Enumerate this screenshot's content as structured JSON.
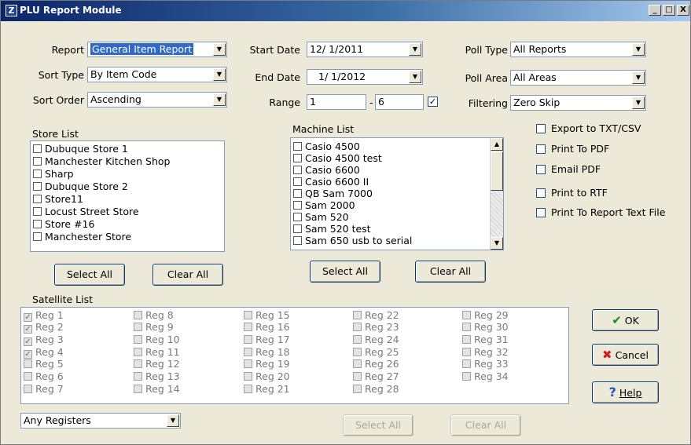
{
  "window": {
    "title": "PLU Report Module",
    "minimize": "_",
    "maximize": "□",
    "close": "X"
  },
  "report": {
    "label": "Report",
    "value": "General Item Report"
  },
  "sort_type": {
    "label": "Sort Type",
    "value": "By Item Code"
  },
  "sort_order": {
    "label": "Sort Order",
    "value": "Ascending"
  },
  "start_date": {
    "label": "Start Date",
    "value": "12/ 1/2011"
  },
  "end_date": {
    "label": "End Date",
    "value": "1/ 1/2012"
  },
  "range": {
    "label": "Range",
    "from": "1",
    "separator": "-",
    "to": "6",
    "checked_mark": "✓"
  },
  "poll_type": {
    "label": "Poll Type",
    "value": "All Reports"
  },
  "poll_area": {
    "label": "Poll Area",
    "value": "All Areas"
  },
  "filtering": {
    "label": "Filtering",
    "value": "Zero Skip"
  },
  "store_list": {
    "label": "Store List",
    "items": [
      "Dubuque Store 1",
      "Manchester Kitchen Shop",
      "Sharp",
      "Dubuque Store 2",
      "Store11",
      "Locust Street Store",
      "Store #16",
      "Manchester Store"
    ],
    "select_all": "Select All",
    "clear_all": "Clear All"
  },
  "machine_list": {
    "label": "Machine List",
    "items": [
      "Casio 4500",
      "Casio 4500 test",
      "Casio 6600",
      "Casio 6600 II",
      "QB Sam 7000",
      "Sam 2000",
      "Sam 520",
      "Sam 520 test",
      "Sam 650 usb to serial"
    ],
    "select_all": "Select All",
    "clear_all": "Clear All"
  },
  "options": {
    "export_txt": "Export to TXT/CSV",
    "print_pdf": "Print To PDF",
    "email_pdf": "Email PDF",
    "print_rtf": "Print to RTF",
    "print_text": "Print To Report Text File"
  },
  "satellite_list": {
    "label": "Satellite List",
    "check_mark": "✓",
    "columns": [
      [
        "Reg 1",
        "Reg 2",
        "Reg 3",
        "Reg 4",
        "Reg 5",
        "Reg 6",
        "Reg 7"
      ],
      [
        "Reg 8",
        "Reg 9",
        "Reg 10",
        "Reg 11",
        "Reg 12",
        "Reg 13",
        "Reg 14"
      ],
      [
        "Reg 15",
        "Reg 16",
        "Reg 17",
        "Reg 18",
        "Reg 19",
        "Reg 20",
        "Reg 21"
      ],
      [
        "Reg 22",
        "Reg 23",
        "Reg 24",
        "Reg 25",
        "Reg 26",
        "Reg 27",
        "Reg 28"
      ],
      [
        "Reg 29",
        "Reg 30",
        "Reg 31",
        "Reg 32",
        "Reg 33",
        "Reg 34"
      ]
    ],
    "select_all": "Select All",
    "clear_all": "Clear All"
  },
  "registers_filter": {
    "value": "Any Registers"
  },
  "buttons": {
    "ok": "OK",
    "ok_icon": "✔",
    "cancel": "Cancel",
    "cancel_icon": "✖",
    "help": "Help",
    "help_icon": "?"
  }
}
